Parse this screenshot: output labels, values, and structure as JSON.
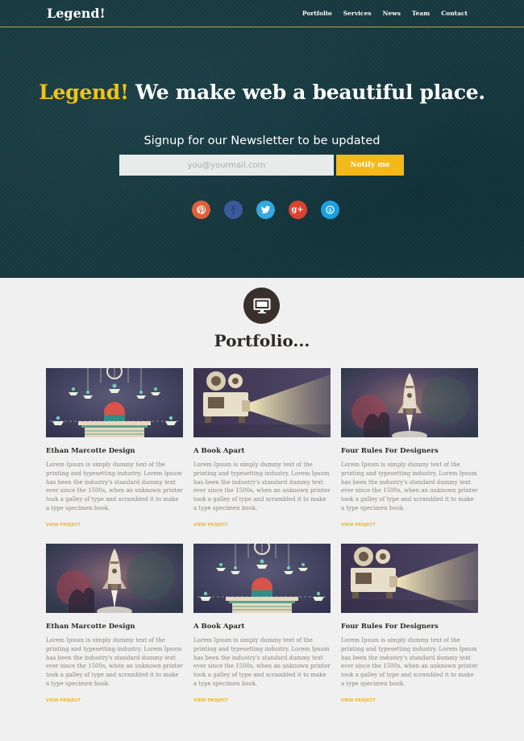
{
  "brand": "Legend!",
  "nav": [
    "Portfolio",
    "Services",
    "News",
    "Team",
    "Contact"
  ],
  "hero": {
    "headline_accent": "Legend!",
    "headline_rest": " We make web a beautiful place.",
    "subtitle": "Signup for our Newsletter to be updated",
    "email_placeholder": "you@yourmail.com",
    "notify_label": "Notify me"
  },
  "socials": [
    {
      "name": "pinterest",
      "color": "#e0603a"
    },
    {
      "name": "facebook",
      "color": "#3a5a9b"
    },
    {
      "name": "twitter",
      "color": "#33a9de"
    },
    {
      "name": "google-plus",
      "color": "#d9432f"
    },
    {
      "name": "skype",
      "color": "#1aa1df"
    }
  ],
  "portfolio": {
    "title": "Portfolio...",
    "items": [
      {
        "title": "Ethan Marcotte Design",
        "art": "birds",
        "body": "Lorem Ipsum is simply dummy text of the printing and typesetting industry. Lorem Ipsum has been the industry's standard dummy text ever since the 1500s, when an unknown printer took a galley of type and scrambled it to make a type specimen book.",
        "link": "VIEW PROJECT"
      },
      {
        "title": "A Book Apart",
        "art": "projector",
        "body": "Lorem Ipsum is simply dummy text of the printing and typesetting industry. Lorem Ipsum has been the industry's standard dummy text ever since the 1500s, when an unknown printer took a galley of type and scrambled it to make a type specimen book.",
        "link": "VIEW PROJECT"
      },
      {
        "title": "Four Rules For Designers",
        "art": "rocket",
        "body": "Lorem Ipsum is simply dummy text of the printing and typesetting industry. Lorem Ipsum has been the industry's standard dummy text ever since the 1500s, when an unknown printer took a galley of type and scrambled it to make a type specimen book.",
        "link": "VIEW PROJECT"
      },
      {
        "title": "Ethan Marcotte Design",
        "art": "rocket",
        "body": "Lorem Ipsum is simply dummy text of the printing and typesetting industry. Lorem Ipsum has been the industry's standard dummy text ever since the 1500s, when an unknown printer took a galley of type and scrambled it to make a type specimen book.",
        "link": "VIEW PROJECT"
      },
      {
        "title": "A Book Apart",
        "art": "birds",
        "body": "Lorem Ipsum is simply dummy text of the printing and typesetting industry. Lorem Ipsum has been the industry's standard dummy text ever since the 1500s, when an unknown printer took a galley of type and scrambled it to make a type specimen book.",
        "link": "VIEW PROJECT"
      },
      {
        "title": "Four Rules For Designers",
        "art": "projector",
        "body": "Lorem Ipsum is simply dummy text of the printing and typesetting industry. Lorem Ipsum has been the industry's standard dummy text ever since the 1500s, when an unknown printer took a galley of type and scrambled it to make a type specimen book.",
        "link": "VIEW PROJECT"
      }
    ]
  }
}
